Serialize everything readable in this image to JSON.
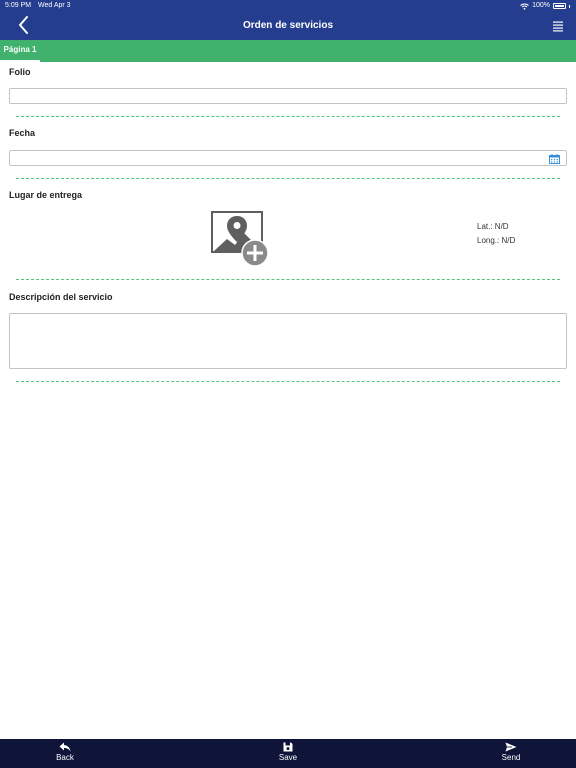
{
  "status_bar": {
    "time": "5:09 PM",
    "date": "Wed Apr 3",
    "battery": "100%",
    "wifi_icon": "wifi-icon",
    "battery_icon": "battery-icon"
  },
  "nav": {
    "title": "Orden de servicios",
    "back_icon": "chevron-left-icon",
    "menu_icon": "hamburger-menu-icon"
  },
  "tabs": [
    {
      "label": "Página 1",
      "active": true
    }
  ],
  "form": {
    "folio": {
      "label": "Folio",
      "value": ""
    },
    "fecha": {
      "label": "Fecha",
      "value": "",
      "icon": "calendar-icon"
    },
    "lugar": {
      "label": "Lugar de entrega",
      "icon": "add-map-location-icon",
      "lat": "Lat.: N/D",
      "long": "Long.: N/D"
    },
    "descripcion": {
      "label": "Descripción del servicio",
      "value": ""
    }
  },
  "toolbar": {
    "back_label": "Back",
    "save_label": "Save",
    "send_label": "Send",
    "back_icon": "reply-arrow-icon",
    "save_icon": "floppy-disk-icon",
    "send_icon": "paper-plane-icon"
  },
  "colors": {
    "nav_bar": "#243d8e",
    "tab_strip": "#40b26d",
    "separator": "#56c47b",
    "bottom_bar": "#0f1538",
    "calendar_icon": "#3a8fd6"
  }
}
